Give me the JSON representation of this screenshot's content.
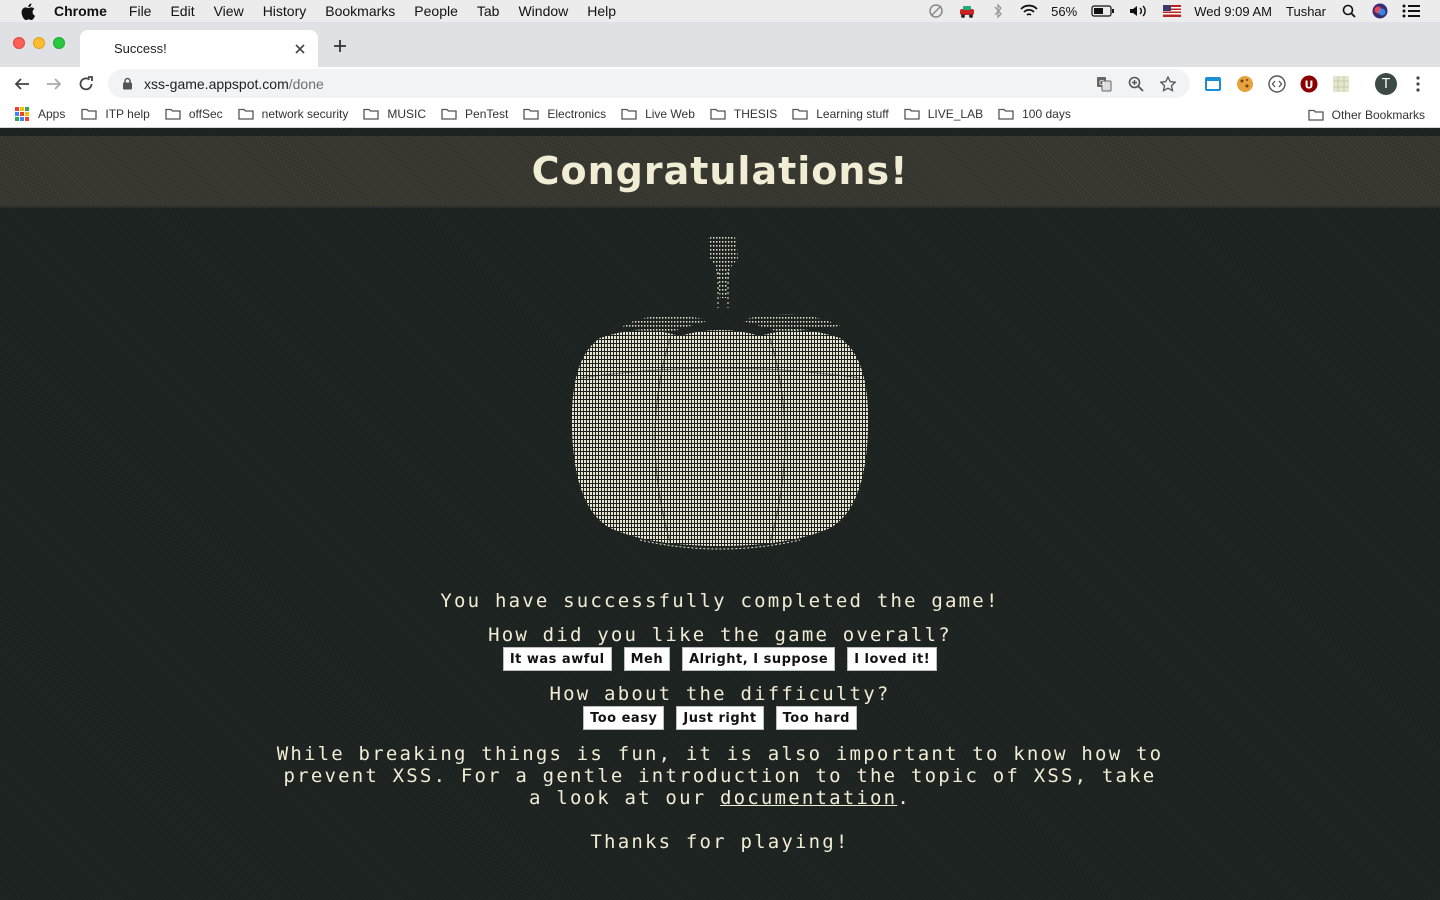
{
  "menubar": {
    "app_name": "Chrome",
    "menus": [
      "File",
      "Edit",
      "View",
      "History",
      "Bookmarks",
      "People",
      "Tab",
      "Window",
      "Help"
    ],
    "battery": "56%",
    "datetime": "Wed 9:09 AM",
    "user": "Tushar"
  },
  "tab": {
    "title": "Success!"
  },
  "toolbar": {
    "url_host": "xss-game.appspot.com",
    "url_path": "/done",
    "profile_initial": "T"
  },
  "bookmarks": {
    "apps_label": "Apps",
    "folders": [
      "ITP help",
      "offSec",
      "network security",
      "MUSIC",
      "PenTest",
      "Electronics",
      "Live Web",
      "THESIS",
      "Learning stuff",
      "LIVE_LAB",
      "100 days"
    ],
    "other": "Other Bookmarks"
  },
  "page": {
    "heading": "Congratulations!",
    "completed": "You have successfully completed the game!",
    "q_overall": "How did you like the game overall?",
    "overall_options": [
      "It was awful",
      "Meh",
      "Alright, I suppose",
      "I loved it!"
    ],
    "q_difficulty": "How about the difficulty?",
    "difficulty_options": [
      "Too easy",
      "Just right",
      "Too hard"
    ],
    "para_before": "While breaking things is fun, it is also important to know how to prevent XSS. For a gentle introduction to the topic of XSS, take a look at our",
    "doc_link": "documentation",
    "para_after": ".",
    "thanks": "Thanks for playing!"
  },
  "colors": {
    "page_bg": "#1b2220",
    "banner_bg": "#3a3a33",
    "text": "#f1ecd4"
  }
}
